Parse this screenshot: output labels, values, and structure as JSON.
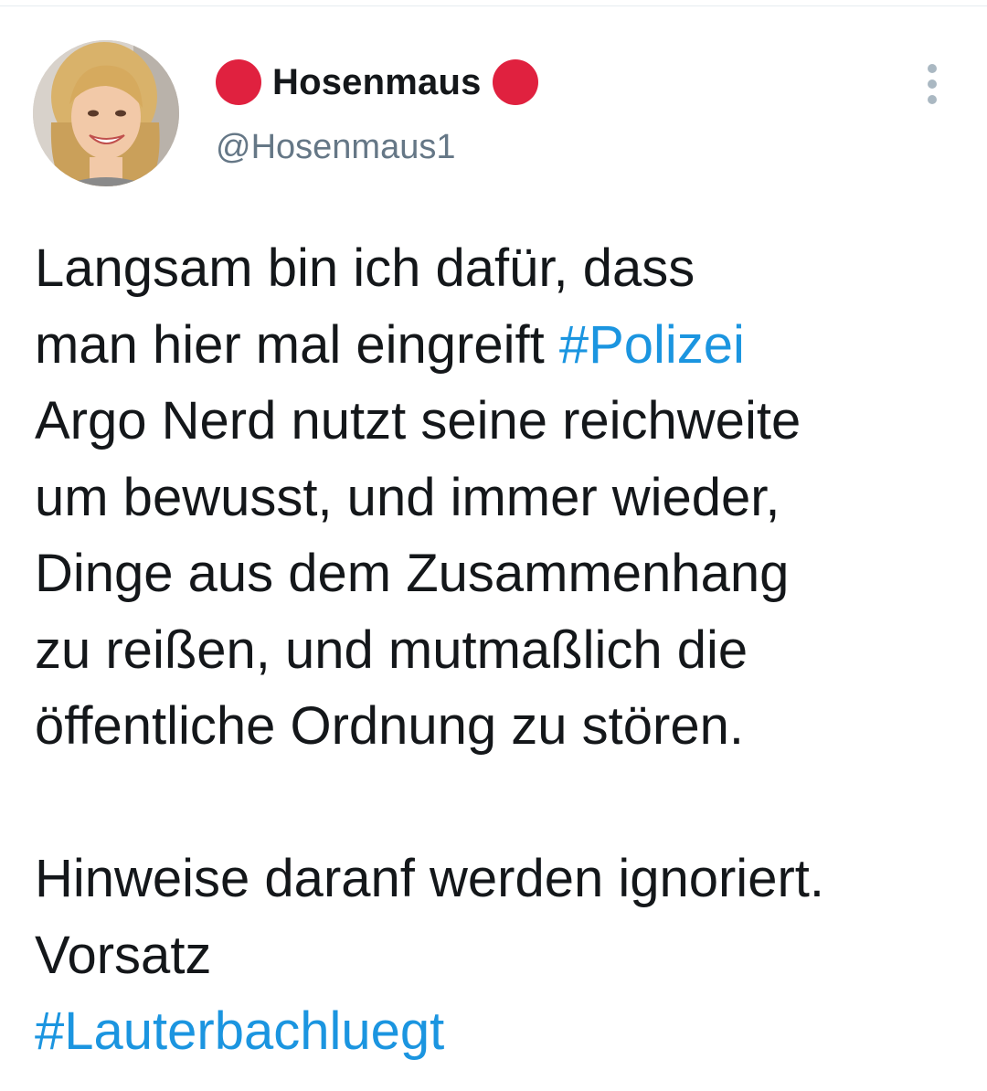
{
  "user": {
    "display_name": "Hosenmaus",
    "handle": "@Hosenmaus1",
    "badge_color": "#e0213f",
    "avatar_icon": "profile-photo"
  },
  "menu": {
    "icon": "more-vertical-icon"
  },
  "tweet": {
    "line1": "Langsam bin ich dafür, dass",
    "line2": "man hier mal eingreift",
    "hashtag1": "#Polizei",
    "line3": "Argo Nerd nutzt seine reichweite",
    "line4": "um bewusst, und immer wieder,",
    "line5": "Dinge aus dem Zusammenhang",
    "line6": "zu reißen, und mutmaßlich die",
    "line7": "öffentliche Ordnung zu stören.",
    "line8": "Hinweise daranf werden ignoriert.",
    "line9": "Vorsatz",
    "hashtag2": "#Lauterbachluegt"
  },
  "colors": {
    "text": "#14171a",
    "handle": "#657786",
    "hashtag": "#1b95e0"
  }
}
